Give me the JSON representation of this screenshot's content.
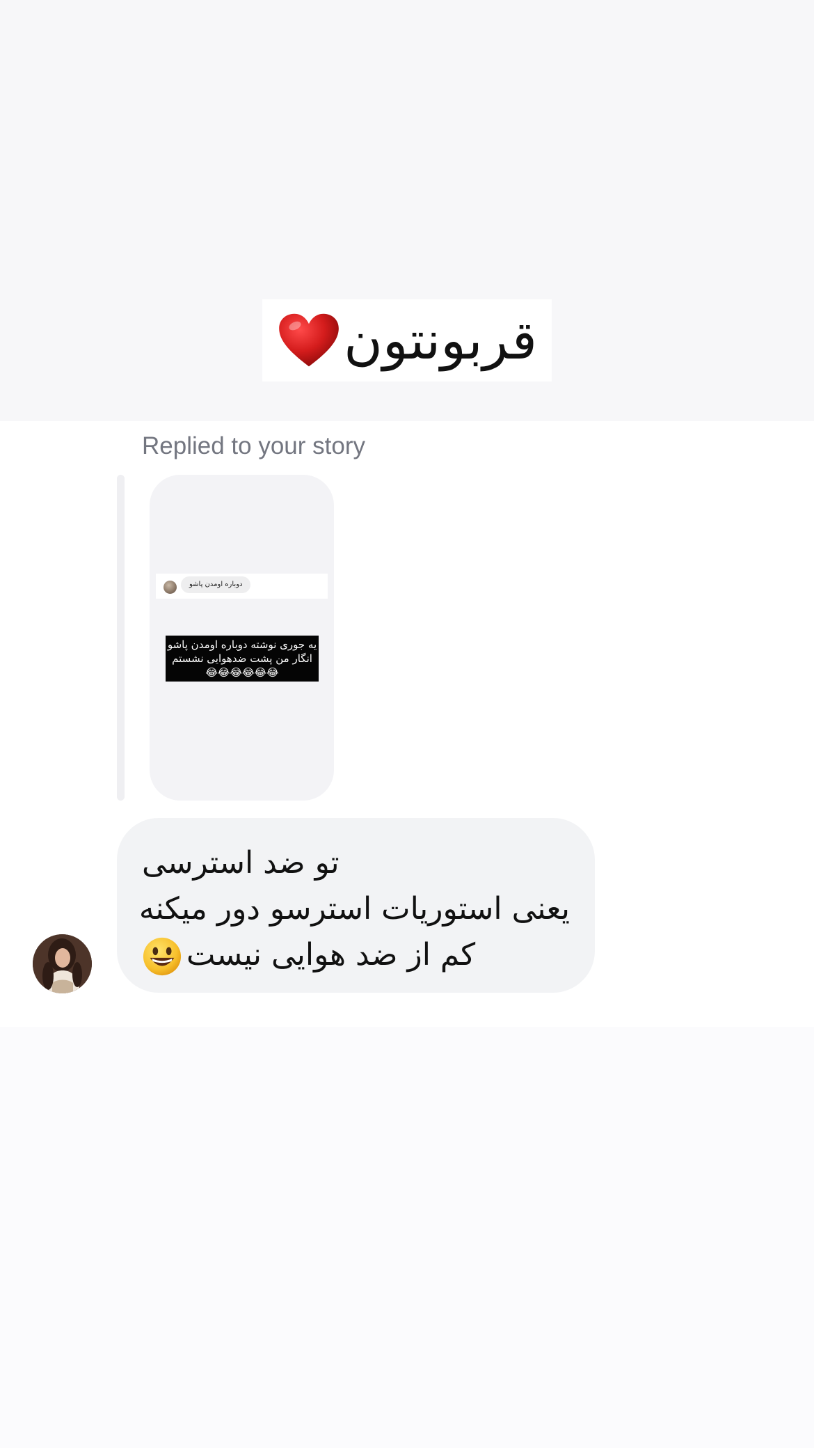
{
  "story_caption": {
    "text": "قربونتون",
    "emoji": "heart-icon"
  },
  "thread": {
    "replied_label": "Replied to your story",
    "story_preview": {
      "pill_text": "دوباره اومدن پاشو",
      "caption_lines": [
        "یه جوری نوشته دوباره اومدن پاشو",
        "انگار من پشت ضدهوایی نشستم",
        "😂😂😂😂😂😂"
      ]
    },
    "message": {
      "lines": [
        "تو ضد استرسی",
        "یعنی استوریات استرسو دور میکنه",
        "کم از ضد هوایی نیست"
      ],
      "trailing_emoji": "grinning-face-icon"
    },
    "sender_avatar": "avatar"
  },
  "colors": {
    "page_background": "#fbfbfd",
    "top_band": "#f7f7f9",
    "thread_background": "#ffffff",
    "bubble_background": "#f2f3f5",
    "secondary_text": "#737680",
    "heart_red": "#d41c1c"
  }
}
